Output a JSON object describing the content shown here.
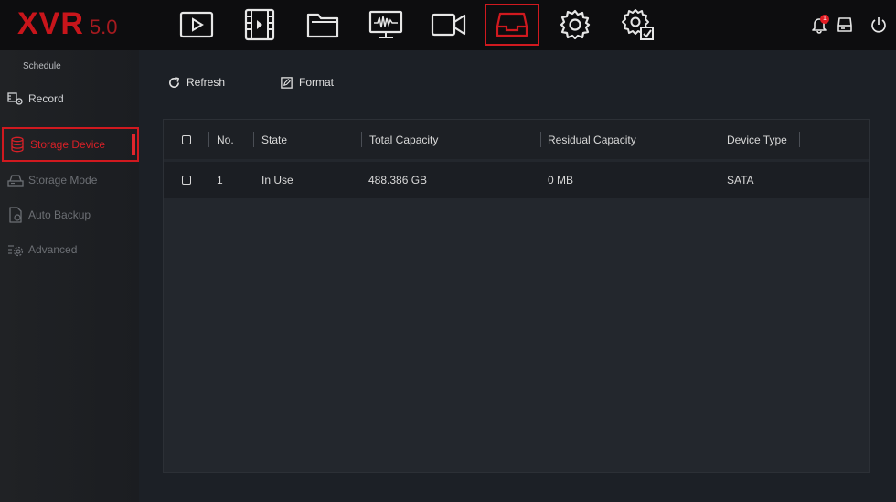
{
  "header": {
    "logo_main": "XVR",
    "logo_version": "5.0",
    "nav": [
      {
        "icon": "playback-icon"
      },
      {
        "icon": "video-clip-icon"
      },
      {
        "icon": "folder-icon"
      },
      {
        "icon": "monitor-waveform-icon"
      },
      {
        "icon": "camera-icon"
      },
      {
        "icon": "storage-tray-icon",
        "active": true
      },
      {
        "icon": "gear-icon"
      },
      {
        "icon": "advanced-settings-icon"
      }
    ],
    "notification_count": "1",
    "accent_color": "#d0191f"
  },
  "sidebar": {
    "heading": "Schedule",
    "items": [
      {
        "label": "Record",
        "icon": "record-schedule-icon"
      },
      {
        "label": "Storage Device",
        "icon": "database-icon",
        "active": true
      },
      {
        "label": "Storage Mode",
        "icon": "hdd-icon"
      },
      {
        "label": "Auto Backup",
        "icon": "backup-file-icon"
      },
      {
        "label": "Advanced",
        "icon": "advanced-gear-icon"
      }
    ]
  },
  "toolbar": {
    "refresh_label": "Refresh",
    "format_label": "Format"
  },
  "table": {
    "columns": [
      "No.",
      "State",
      "Total Capacity",
      "Residual Capacity",
      "Device Type"
    ],
    "rows": [
      {
        "no": "1",
        "state": "In Use",
        "total": "488.386 GB",
        "residual": "0 MB",
        "type": "SATA"
      }
    ]
  }
}
